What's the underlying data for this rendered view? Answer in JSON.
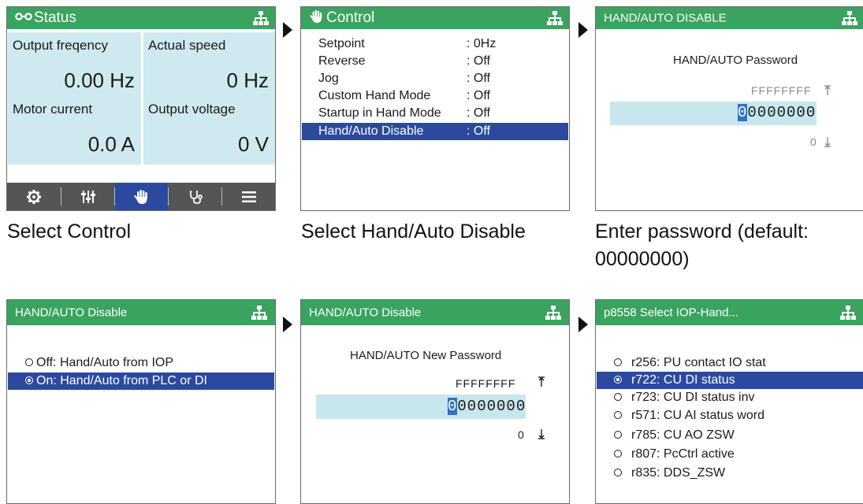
{
  "colors": {
    "header_green": "#3aa35f",
    "selection_blue": "#2b4a9f",
    "cell_blue": "#cfe9f0",
    "navbar_gray": "#555555"
  },
  "status_panel": {
    "title": "Status",
    "title_icon": "glasses-icon",
    "network_icon": "network-icon",
    "cells": [
      {
        "label": "Output freqency",
        "value": "0.00 Hz"
      },
      {
        "label": "Actual speed",
        "value": "0 Hz"
      },
      {
        "label": "Motor current",
        "value": "0.0 A"
      },
      {
        "label": "Output voltage",
        "value": "0 V"
      }
    ],
    "nav_icons": [
      "gear-icon",
      "sliders-icon",
      "hand-icon",
      "stethoscope-icon",
      "menu-icon"
    ],
    "active_nav": "hand-icon"
  },
  "control_panel": {
    "title": "Control",
    "title_icon": "hand-icon",
    "items": [
      {
        "label": "Setpoint",
        "value": ": 0Hz"
      },
      {
        "label": "Reverse",
        "value": ": Off"
      },
      {
        "label": "Jog",
        "value": ": Off"
      },
      {
        "label": "Custom Hand Mode",
        "value": ": Off"
      },
      {
        "label": "Startup in Hand Mode",
        "value": ": Off"
      },
      {
        "label": "Hand/Auto Disable",
        "value": ": Off"
      }
    ],
    "selected": "Hand/Auto Disable"
  },
  "password_panel": {
    "title": "HAND/AUTO DISABLE",
    "prompt": "HAND/AUTO Password",
    "max_value": "FFFFFFFF",
    "input_first": "0",
    "input_rest": "0000000",
    "min_value": "0"
  },
  "disable_panel": {
    "title": "HAND/AUTO Disable",
    "options": [
      {
        "label": "Off: Hand/Auto from IOP",
        "selected": false
      },
      {
        "label": "On: Hand/Auto from PLC or DI",
        "selected": true
      }
    ]
  },
  "newpw_panel": {
    "title": "HAND/AUTO Disable",
    "prompt": "HAND/AUTO New Password",
    "max_value": "FFFFFFFF",
    "input_first": "0",
    "input_rest": "0000000",
    "min_value": "0"
  },
  "select_panel": {
    "title": "p8558 Select IOP-Hand...",
    "options": [
      {
        "label": "r256: PU contact IO stat",
        "selected": false
      },
      {
        "label": "r722: CU DI status",
        "selected": true
      },
      {
        "label": "r723: CU DI status inv",
        "selected": false
      },
      {
        "label": "r571: CU AI status word",
        "selected": false
      },
      {
        "label": "r785: CU AO ZSW",
        "selected": false
      },
      {
        "label": "r807: PcCtrl active",
        "selected": false
      },
      {
        "label": "r835: DDS_ZSW",
        "selected": false
      }
    ]
  },
  "captions": {
    "c1": "Select Control",
    "c2": "Select Hand/Auto Disable",
    "c3_line1": "Enter password (default:",
    "c3_line2": "00000000)"
  }
}
